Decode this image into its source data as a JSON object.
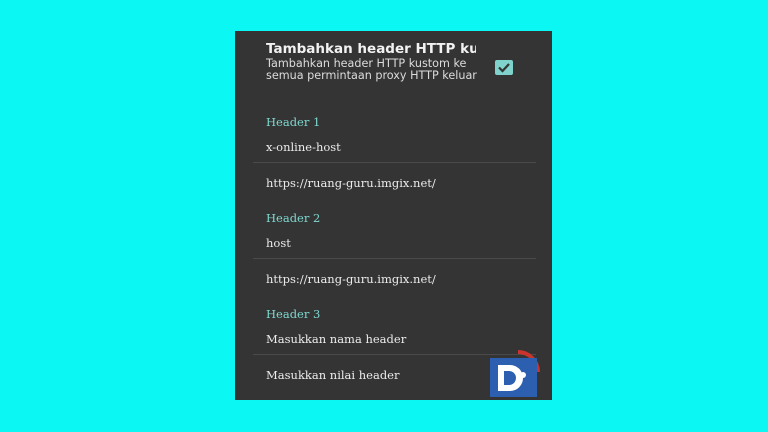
{
  "toggle": {
    "title": "Tambahkan header HTTP ku..",
    "description": "Tambahkan header HTTP kustom ke semua permintaan proxy HTTP keluar",
    "checked": true
  },
  "headers": [
    {
      "section": "Header 1",
      "name": "x-online-host",
      "value": "https://ruang-guru.imgix.net/"
    },
    {
      "section": "Header 2",
      "name": "host",
      "value": "https://ruang-guru.imgix.net/"
    },
    {
      "section": "Header 3",
      "name": "Masukkan nama header",
      "value": "Masukkan nilai header"
    }
  ],
  "colors": {
    "background": "#0af7f4",
    "panel": "#343434",
    "accent": "#7fd8d0",
    "logo_blue": "#2d5fb0",
    "logo_red": "#c9342e"
  },
  "icons": {
    "checkbox": "check-icon",
    "watermark": "d-logo-icon"
  }
}
